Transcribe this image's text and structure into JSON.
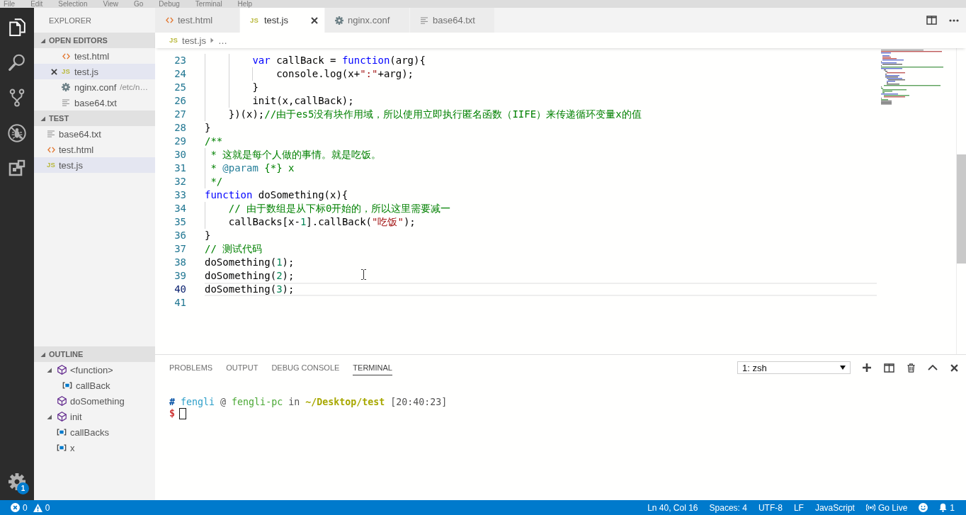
{
  "menu_bar": {
    "items": [
      "File",
      "Edit",
      "Selection",
      "View",
      "Go",
      "Debug",
      "Terminal",
      "Help"
    ]
  },
  "activity_bar": {
    "items": [
      {
        "kind": "files",
        "selected": true
      },
      {
        "kind": "search",
        "selected": false
      },
      {
        "kind": "source_control",
        "selected": false
      },
      {
        "kind": "debug",
        "selected": false
      },
      {
        "kind": "extensions",
        "selected": false
      }
    ],
    "settings_badge": "1"
  },
  "sidebar": {
    "title": "EXPLORER",
    "sections": [
      {
        "kind": "editors",
        "title": "OPEN EDITORS",
        "expanded": true,
        "items": [
          {
            "kind": "html",
            "name": "test.html",
            "selected": false
          },
          {
            "kind": "js",
            "icon_text": "JS",
            "name": "test.js",
            "selected": true
          },
          {
            "kind": "conf",
            "name": "nginx.conf",
            "description": "/etc/n…",
            "selected": false
          },
          {
            "kind": "txt",
            "name": "base64.txt",
            "selected": false
          }
        ]
      },
      {
        "kind": "folder",
        "title": "TEST",
        "expanded": true,
        "items": [
          {
            "kind": "txt",
            "name": "base64.txt",
            "selected": false
          },
          {
            "kind": "html",
            "name": "test.html",
            "selected": false
          },
          {
            "kind": "js",
            "icon_text": "JS",
            "name": "test.js",
            "selected": true
          }
        ]
      }
    ],
    "outline": {
      "title": "OUTLINE",
      "expanded": true,
      "items": [
        {
          "kind": "function",
          "name": "<function>",
          "expanded": true,
          "selected": false,
          "children": [
            {
              "kind": "variable",
              "name": "callBack",
              "selected": false
            }
          ]
        },
        {
          "kind": "function",
          "name": "doSomething",
          "selected": false
        },
        {
          "kind": "function",
          "name": "init",
          "expanded": true,
          "selected": false
        },
        {
          "kind": "variable",
          "name": "callBacks",
          "selected": false
        },
        {
          "kind": "variable",
          "name": "x",
          "selected": false
        }
      ]
    }
  },
  "editor": {
    "tabs": [
      {
        "kind": "html",
        "name": "test.html",
        "selected": false
      },
      {
        "kind": "js",
        "icon_text": "JS",
        "name": "test.js",
        "selected": true
      },
      {
        "kind": "conf",
        "name": "nginx.conf",
        "selected": false
      },
      {
        "kind": "txt",
        "name": "base64.txt",
        "selected": false
      }
    ],
    "breadcrumb": {
      "icon_text": "JS",
      "items": [
        "test.js",
        "…"
      ]
    },
    "lines": [
      {
        "number": "23",
        "current": false,
        "tokens": [
          {
            "kind": "keyword",
            "text": "        var"
          },
          {
            "kind": "plain",
            "text": " callBack = "
          },
          {
            "kind": "keyword",
            "text": "function"
          },
          {
            "kind": "plain",
            "text": "(arg){"
          }
        ]
      },
      {
        "number": "24",
        "current": false,
        "tokens": [
          {
            "kind": "plain",
            "text": "            console.log(x+"
          },
          {
            "kind": "string",
            "text": "\":\""
          },
          {
            "kind": "plain",
            "text": "+arg);"
          }
        ]
      },
      {
        "number": "25",
        "current": false,
        "tokens": [
          {
            "kind": "plain",
            "text": "        }"
          }
        ]
      },
      {
        "number": "26",
        "current": false,
        "tokens": [
          {
            "kind": "plain",
            "text": "        init(x,callBack);"
          }
        ]
      },
      {
        "number": "27",
        "current": false,
        "tokens": [
          {
            "kind": "plain",
            "text": "    })(x);"
          },
          {
            "kind": "comment",
            "text": "//由于es5没有块作用域，所以使用立即执行匿名函数（IIFE）来传递循环变量x的值"
          }
        ]
      },
      {
        "number": "28",
        "current": false,
        "tokens": [
          {
            "kind": "plain",
            "text": "}"
          }
        ]
      },
      {
        "number": "29",
        "current": false,
        "tokens": [
          {
            "kind": "comment",
            "text": "/**"
          }
        ]
      },
      {
        "number": "30",
        "current": false,
        "tokens": [
          {
            "kind": "comment",
            "text": " * 这就是每个人做的事情。就是吃饭。"
          }
        ]
      },
      {
        "number": "31",
        "current": false,
        "tokens": [
          {
            "kind": "comment",
            "text": " * "
          },
          {
            "kind": "doc_tag",
            "text": "@param"
          },
          {
            "kind": "comment",
            "text": " {*} x"
          }
        ]
      },
      {
        "number": "32",
        "current": false,
        "tokens": [
          {
            "kind": "comment",
            "text": " */"
          }
        ]
      },
      {
        "number": "33",
        "current": false,
        "tokens": [
          {
            "kind": "keyword",
            "text": "function"
          },
          {
            "kind": "plain",
            "text": " doSomething(x){"
          }
        ]
      },
      {
        "number": "34",
        "current": false,
        "tokens": [
          {
            "kind": "comment",
            "text": "    // 由于数组是从下标0开始的，所以这里需要减一"
          }
        ]
      },
      {
        "number": "35",
        "current": false,
        "tokens": [
          {
            "kind": "plain",
            "text": "    callBacks[x-"
          },
          {
            "kind": "number",
            "text": "1"
          },
          {
            "kind": "plain",
            "text": "].callBack("
          },
          {
            "kind": "string",
            "text": "\"吃饭\""
          },
          {
            "kind": "plain",
            "text": ");"
          }
        ]
      },
      {
        "number": "36",
        "current": false,
        "tokens": [
          {
            "kind": "plain",
            "text": "}"
          }
        ]
      },
      {
        "number": "37",
        "current": false,
        "tokens": [
          {
            "kind": "comment",
            "text": "// 测试代码"
          }
        ]
      },
      {
        "number": "38",
        "current": false,
        "tokens": [
          {
            "kind": "plain",
            "text": "doSomething("
          },
          {
            "kind": "number",
            "text": "1"
          },
          {
            "kind": "plain",
            "text": ");"
          }
        ]
      },
      {
        "number": "39",
        "current": false,
        "tokens": [
          {
            "kind": "plain",
            "text": "doSomething("
          },
          {
            "kind": "number",
            "text": "2"
          },
          {
            "kind": "plain",
            "text": ");"
          }
        ]
      },
      {
        "number": "40",
        "current": true,
        "tokens": [
          {
            "kind": "plain",
            "text": "doSomething("
          },
          {
            "kind": "number",
            "text": "3"
          },
          {
            "kind": "plain",
            "text": ");"
          }
        ]
      },
      {
        "number": "41",
        "current": false
      }
    ]
  },
  "panel": {
    "tabs": [
      {
        "label": "PROBLEMS",
        "selected": false
      },
      {
        "label": "OUTPUT",
        "selected": false
      },
      {
        "label": "DEBUG CONSOLE",
        "selected": false
      },
      {
        "label": "TERMINAL",
        "selected": true
      }
    ],
    "terminal_select": "1: zsh",
    "terminal": {
      "lines": [
        {
          "cursor": false,
          "segments": [
            {
              "kind": "hash",
              "text": "#"
            },
            {
              "kind": "user",
              "text": " fengli"
            },
            {
              "kind": "plain",
              "text": " @ "
            },
            {
              "kind": "host",
              "text": "fengli-pc"
            },
            {
              "kind": "plain",
              "text": " in "
            },
            {
              "kind": "path",
              "text": "~/Desktop/test"
            },
            {
              "kind": "plain",
              "text": " [20:40:23]"
            }
          ]
        },
        {
          "cursor": true,
          "segments": [
            {
              "kind": "prompt",
              "text": "$"
            }
          ]
        }
      ]
    }
  },
  "status_bar": {
    "errors": "0",
    "warnings": "0",
    "items": [
      {
        "kind": "text",
        "label": "Ln 40, Col 16"
      },
      {
        "kind": "text",
        "label": "Spaces: 4"
      },
      {
        "kind": "text",
        "label": "UTF-8"
      },
      {
        "kind": "text",
        "label": "LF"
      },
      {
        "kind": "text",
        "label": "JavaScript"
      },
      {
        "kind": "live",
        "label": "Go Live"
      },
      {
        "kind": "feedback"
      },
      {
        "kind": "notifications",
        "label": "1"
      }
    ]
  }
}
